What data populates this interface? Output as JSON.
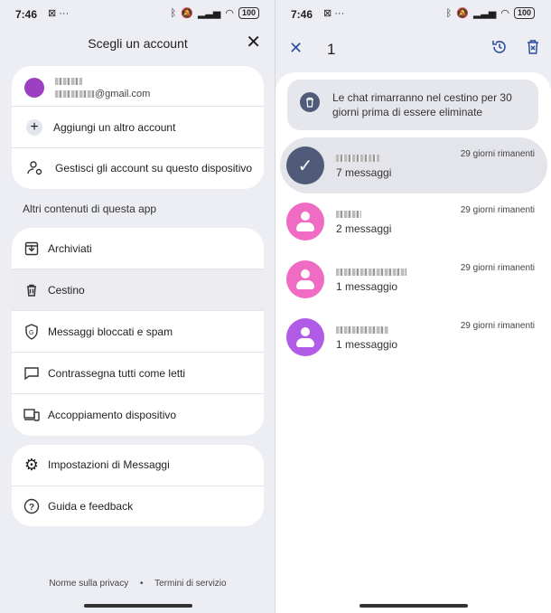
{
  "colors": {
    "accent_purple": "#9c3fc0",
    "selected_avatar": "#4f5b78",
    "pink_avatar": "#f06cc4",
    "violet_avatar": "#b15ce6"
  },
  "status_bar": {
    "time": "7:46",
    "battery": "100"
  },
  "left": {
    "title": "Scegli un account",
    "account": {
      "email_suffix": "@gmail.com"
    },
    "account_actions": [
      {
        "icon": "plus-icon",
        "label": "Aggiungi un altro account"
      },
      {
        "icon": "manage-accounts-icon",
        "label": "Gestisci gli account su questo dispositivo"
      }
    ],
    "section_label": "Altri contenuti di questa app",
    "menu": [
      {
        "icon": "archive-icon",
        "label": "Archiviati"
      },
      {
        "icon": "trash-icon",
        "label": "Cestino"
      },
      {
        "icon": "shield-icon",
        "label": "Messaggi bloccati e spam"
      },
      {
        "icon": "mark-read-icon",
        "label": "Contrassegna tutti come letti"
      },
      {
        "icon": "device-pairing-icon",
        "label": "Accoppiamento dispositivo"
      }
    ],
    "settings": [
      {
        "icon": "gear-icon",
        "label": "Impostazioni di Messaggi"
      },
      {
        "icon": "help-icon",
        "label": "Guida e feedback"
      }
    ],
    "footer": {
      "privacy": "Norme sulla privacy",
      "bullet": "•",
      "terms": "Termini di servizio"
    }
  },
  "right": {
    "selected_count": "1",
    "banner": "Le chat rimarranno nel cestino per 30 giorni prima di essere eliminate",
    "conversations": [
      {
        "messages": "7 messaggi",
        "days_left": "29 giorni rimanenti",
        "selected": true
      },
      {
        "messages": "2 messaggi",
        "days_left": "29 giorni rimanenti"
      },
      {
        "messages": "1 messaggio",
        "days_left": "29 giorni rimanenti"
      },
      {
        "messages": "1 messaggio",
        "days_left": "29 giorni rimanenti"
      }
    ]
  }
}
